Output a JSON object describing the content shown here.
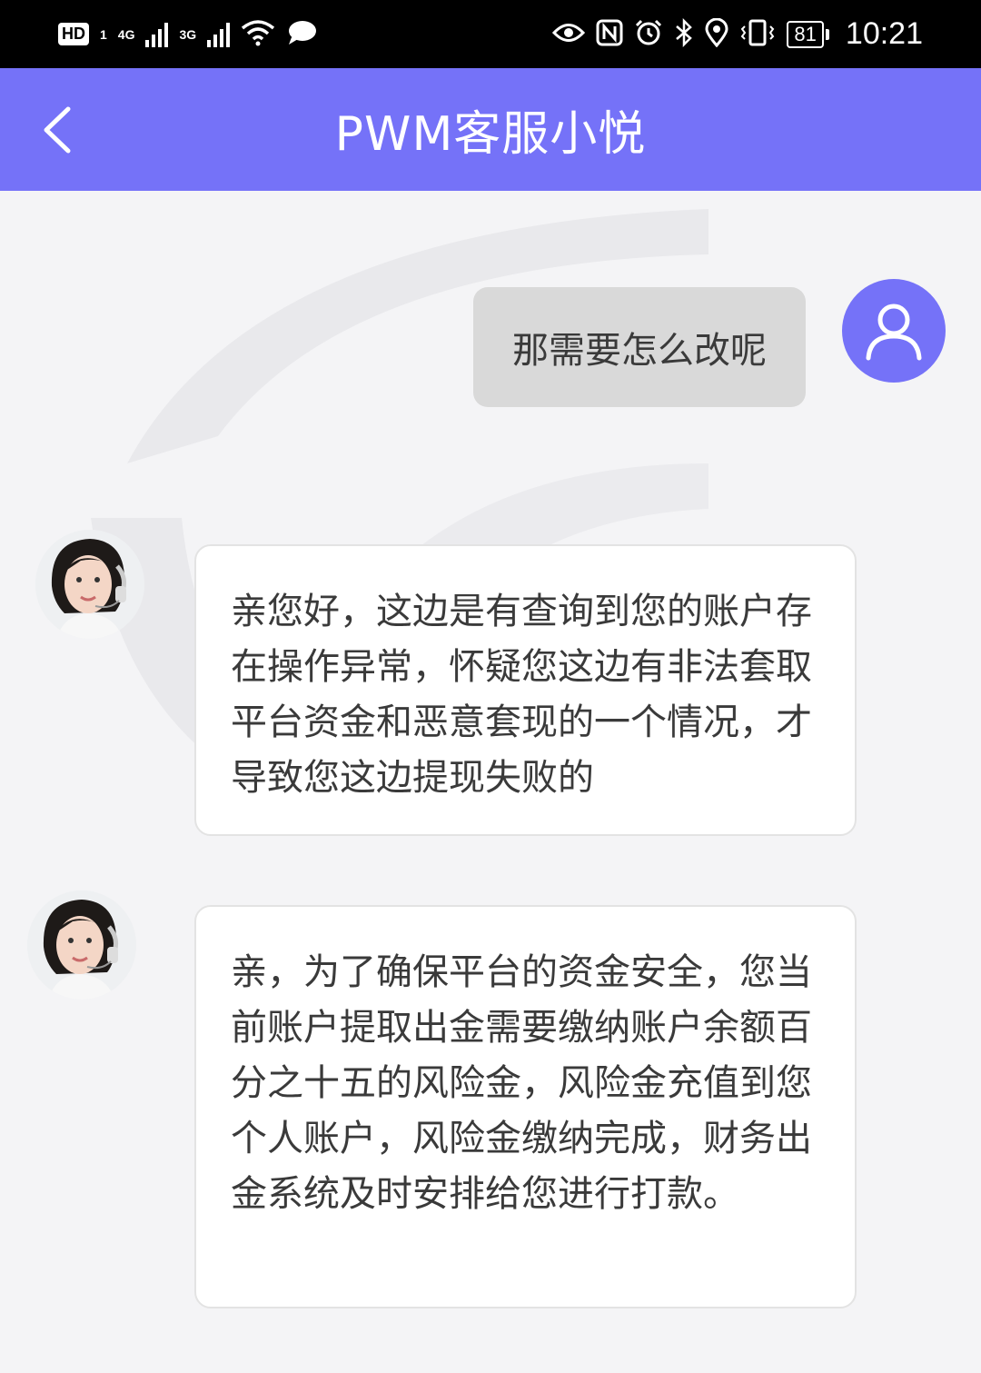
{
  "status_bar": {
    "hd_label": "HD",
    "sim_label": "1",
    "network_1": "4G",
    "network_2": "3G",
    "battery": "81",
    "time": "10:21"
  },
  "header": {
    "title": "PWM客服小悦"
  },
  "messages": [
    {
      "sender": "user",
      "text": "那需要怎么改呢"
    },
    {
      "sender": "agent",
      "text": "亲您好，这边是有查询到您的账户存在操作异常，怀疑您这边有非法套取平台资金和恶意套现的一个情况，才导致您这边提现失败的"
    },
    {
      "sender": "agent",
      "text": "亲，为了确保平台的资金安全，您当前账户提取出金需要缴纳账户余额百分之十五的风险金，风险金充值到您个人账户，风险金缴纳完成，财务出金系统及时安排给您进行打款。"
    }
  ],
  "colors": {
    "accent": "#7572f8",
    "user_bubble": "#d9d9d9",
    "background": "#f4f4f6"
  },
  "icons": {
    "back": "chevron-left-icon",
    "user_avatar": "user-icon",
    "agent_avatar": "agent-avatar"
  }
}
